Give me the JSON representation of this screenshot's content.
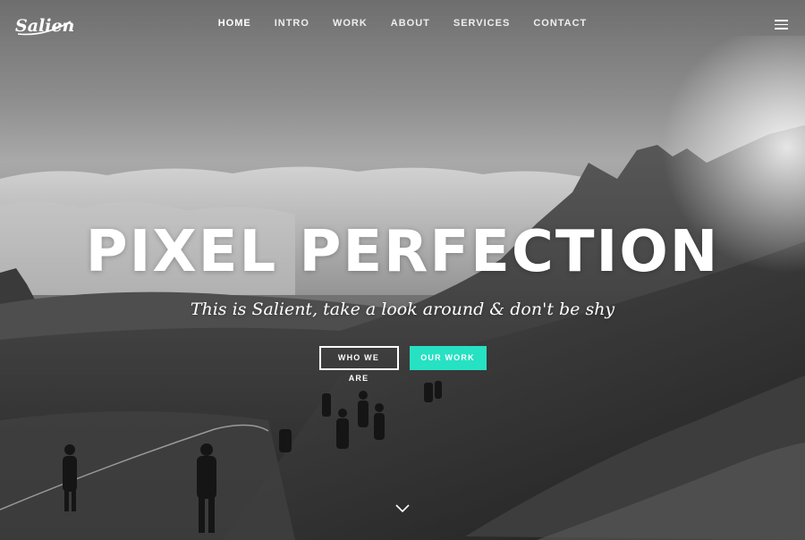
{
  "brand": {
    "logo_text": "Salient"
  },
  "nav": {
    "items": [
      {
        "label": "HOME",
        "active": true
      },
      {
        "label": "INTRO",
        "active": false
      },
      {
        "label": "WORK",
        "active": false
      },
      {
        "label": "ABOUT",
        "active": false
      },
      {
        "label": "SERVICES",
        "active": false
      },
      {
        "label": "CONTACT",
        "active": false
      }
    ],
    "menu_icon": "hamburger-icon"
  },
  "hero": {
    "headline": "PIXEL PERFECTION",
    "subtitle": "This is Salient, take a look around & don't be shy",
    "buttons": {
      "primary_label": "WHO WE ARE",
      "secondary_label": "OUR WORK"
    },
    "scroll_icon": "chevron-down-icon",
    "background_image": "grayscale photo of hikers climbing a rocky mountain above a sea of clouds"
  },
  "colors": {
    "accent": "#27e1c3",
    "text": "#ffffff"
  }
}
